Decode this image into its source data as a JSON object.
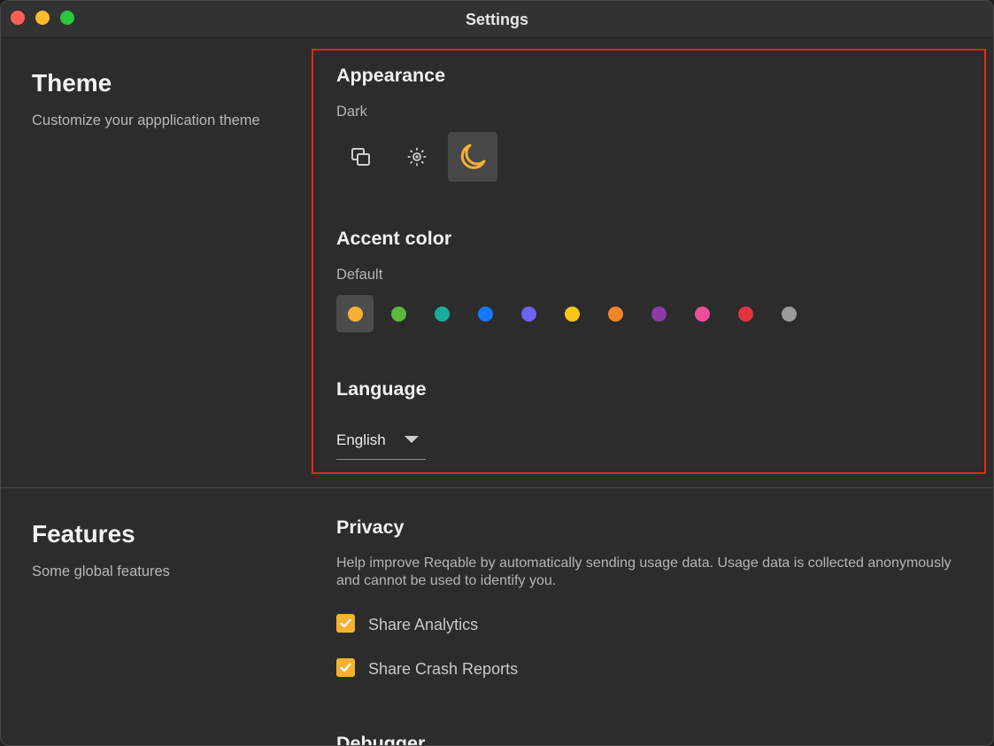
{
  "window": {
    "title": "Settings"
  },
  "theme": {
    "title": "Theme",
    "description": "Customize your appplication theme",
    "appearance": {
      "heading": "Appearance",
      "current": "Dark",
      "modes": [
        {
          "name": "system",
          "icon": "system-icon",
          "selected": false
        },
        {
          "name": "light",
          "icon": "sun-icon",
          "selected": false
        },
        {
          "name": "dark",
          "icon": "moon-icon",
          "selected": true
        }
      ]
    },
    "accent": {
      "heading": "Accent color",
      "current": "Default",
      "colors": [
        "#f6b133",
        "#5cb83c",
        "#1bab9a",
        "#1677ff",
        "#6c63f0",
        "#fac617",
        "#f2862a",
        "#8b3ba6",
        "#ee4d9a",
        "#e0343f",
        "#9a9a9a"
      ],
      "selected_index": 0
    },
    "language": {
      "heading": "Language",
      "value": "English"
    }
  },
  "features": {
    "title": "Features",
    "description": "Some global features",
    "privacy": {
      "heading": "Privacy",
      "text": "Help improve Reqable by automatically sending usage data. Usage data is collected anonymously and cannot be used to identify you.",
      "options": [
        {
          "label": "Share Analytics",
          "checked": true
        },
        {
          "label": "Share Crash Reports",
          "checked": true
        }
      ]
    },
    "debugger": {
      "heading": "Debugger"
    }
  },
  "colors": {
    "accent": "#f6b133",
    "highlight_border": "#e8261a"
  }
}
